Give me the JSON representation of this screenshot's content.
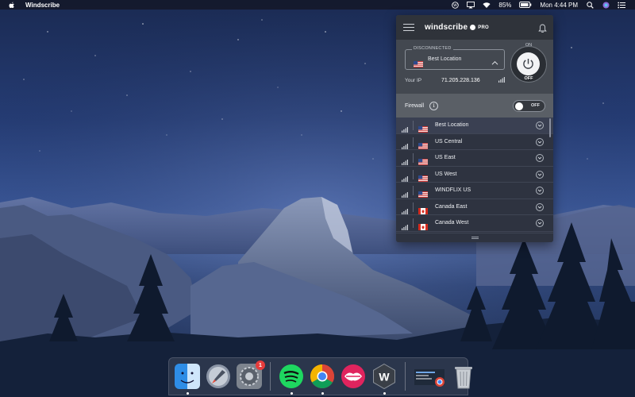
{
  "menubar": {
    "app_name": "Windscribe",
    "battery_percent": "85%",
    "clock": "Mon 4:44 PM",
    "icons": [
      "apple-icon",
      "windscribe-menubar-icon",
      "airplay-icon",
      "wifi-icon",
      "battery-icon",
      "search-icon",
      "siri-icon",
      "notification-center-icon"
    ]
  },
  "windscribe": {
    "brand": "windscribe",
    "plan": "PRO",
    "connection_status": "DISCONNECTED",
    "selected_location": "Best Location",
    "ip_label": "Your IP",
    "ip_value": "71.205.228.136",
    "power_on_label": "ON",
    "power_off_label": "OFF",
    "firewall_label": "Firewall",
    "firewall_state": "OFF",
    "locations": [
      {
        "name": "Best Location",
        "flag": "us"
      },
      {
        "name": "US Central",
        "flag": "us"
      },
      {
        "name": "US East",
        "flag": "us"
      },
      {
        "name": "US West",
        "flag": "us"
      },
      {
        "name": "WINDFLIX US",
        "flag": "us"
      },
      {
        "name": "Canada East",
        "flag": "ca"
      },
      {
        "name": "Canada West",
        "flag": "ca"
      }
    ],
    "colors": {
      "window_bg": "#3b4048",
      "list_bg": "#2e3340",
      "firewall_bg": "#5a5f66"
    }
  },
  "dock": {
    "apps": [
      {
        "name": "Finder",
        "icon": "finder-icon"
      },
      {
        "name": "Launchpad",
        "icon": "launchpad-icon"
      },
      {
        "name": "System Preferences",
        "icon": "system-preferences-icon",
        "badge": "1"
      },
      {
        "name": "Spotify",
        "icon": "spotify-icon"
      },
      {
        "name": "Chrome",
        "icon": "chrome-icon"
      },
      {
        "name": "Cue",
        "icon": "lips-app-icon"
      },
      {
        "name": "Windscribe",
        "icon": "windscribe-dock-icon"
      },
      {
        "name": "Window Preview",
        "icon": "window-preview-icon"
      },
      {
        "name": "Trash",
        "icon": "trash-icon"
      }
    ]
  }
}
